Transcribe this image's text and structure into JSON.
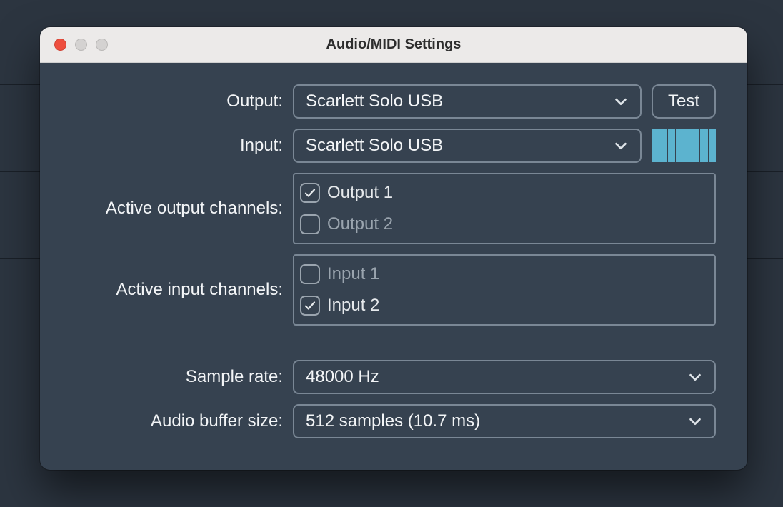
{
  "title": "Audio/MIDI Settings",
  "labels": {
    "output": "Output:",
    "input": "Input:",
    "active_output": "Active output channels:",
    "active_input": "Active input channels:",
    "sample_rate": "Sample rate:",
    "buffer_size": "Audio buffer size:"
  },
  "output": {
    "device": "Scarlett Solo USB",
    "test_label": "Test"
  },
  "input": {
    "device": "Scarlett Solo USB"
  },
  "output_channels": [
    {
      "label": "Output 1",
      "checked": true
    },
    {
      "label": "Output 2",
      "checked": false
    }
  ],
  "input_channels": [
    {
      "label": "Input 1",
      "checked": false
    },
    {
      "label": "Input 2",
      "checked": true
    }
  ],
  "sample_rate": "48000 Hz",
  "buffer_size": "512 samples (10.7 ms)",
  "meter_segments": 8,
  "meter_lit": 8
}
